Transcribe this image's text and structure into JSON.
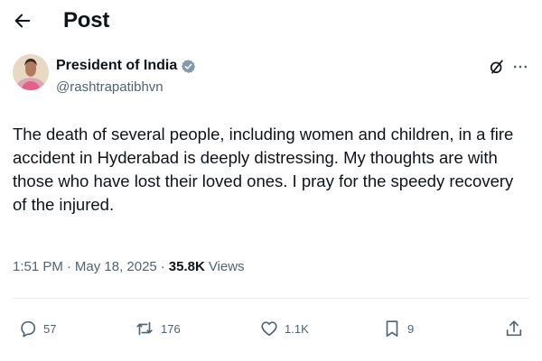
{
  "header": {
    "back_icon": "arrow-left-icon",
    "title": "Post"
  },
  "author": {
    "name": "President of India",
    "handle": "@rashtrapatibhvn",
    "verified_icon": "verified-badge-icon",
    "verified_color": "#829aab",
    "avatar_icon": "profile-photo"
  },
  "post": {
    "text": "The death of several people, including women and children, in a fire accident in Hyderabad is deeply distressing. My thoughts are with those who have lost their loved ones. I pray for the speedy recovery of the injured."
  },
  "meta": {
    "time": "1:51 PM",
    "separator_1": "·",
    "date": "May 18, 2025",
    "separator_2": "·",
    "views_count": "35.8K",
    "views_label": "Views"
  },
  "actions": {
    "reply_count": "57",
    "repost_count": "176",
    "like_count": "1.1K",
    "bookmark_count": "9",
    "icons": [
      "reply-icon",
      "repost-icon",
      "like-icon",
      "bookmark-icon",
      "share-icon"
    ]
  },
  "colors": {
    "text_primary": "#0f1419",
    "text_secondary": "#536471",
    "divider": "#e6e9ea"
  }
}
